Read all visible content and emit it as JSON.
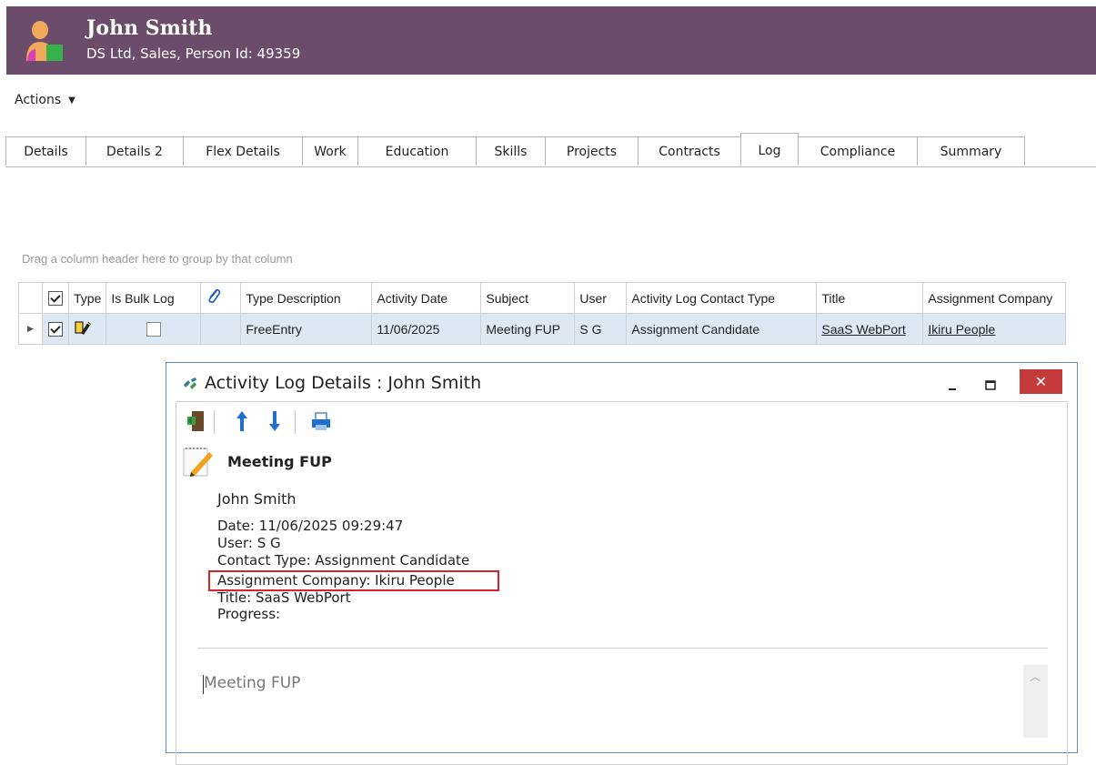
{
  "header": {
    "name": "John Smith",
    "subtitle": "DS Ltd, Sales, Person Id: 49359",
    "bg_color": "#6b4c6a",
    "avatar_icon": "person-avatar-icon"
  },
  "actions": {
    "label": "Actions",
    "caret_icon": "caret-down-icon"
  },
  "tabs": [
    {
      "label": "Details"
    },
    {
      "label": "Details 2"
    },
    {
      "label": "Flex Details"
    },
    {
      "label": "Work"
    },
    {
      "label": "Education"
    },
    {
      "label": "Skills"
    },
    {
      "label": "Projects"
    },
    {
      "label": "Contracts"
    },
    {
      "label": "Log",
      "active": true
    },
    {
      "label": "Compliance"
    },
    {
      "label": "Summary"
    }
  ],
  "grid": {
    "group_hint": "Drag a column header here to group by that column",
    "columns": {
      "type": "Type",
      "is_bulk_log": "Is Bulk Log",
      "attachment_icon": "paperclip-icon",
      "type_description": "Type Description",
      "activity_date": "Activity Date",
      "subject": "Subject",
      "user": "User",
      "contact_type": "Activity Log Contact Type",
      "title": "Title",
      "assignment_company": "Assignment Company"
    },
    "row": {
      "type_icon": "free-entry-icon",
      "type_description": "FreeEntry",
      "activity_date": "11/06/2025",
      "subject": "Meeting FUP",
      "user": "S G",
      "contact_type": "Assignment Candidate",
      "title": "SaaS WebPort",
      "assignment_company": "Ikiru People"
    }
  },
  "dialog": {
    "title": "Activity Log Details : John Smith",
    "close_label": "✕",
    "toolbar": [
      "exit-icon",
      "arrow-up-icon",
      "arrow-down-icon",
      "print-icon"
    ],
    "subject": "Meeting FUP",
    "contact": "John Smith",
    "details": {
      "date": "Date: 11/06/2025 09:29:47",
      "user": "User: S G",
      "contact_type": "Contact Type: Assignment Candidate",
      "assignment_company": "Assignment Company: Ikiru People",
      "title": "Title: SaaS WebPort",
      "progress": "Progress:"
    },
    "note_text": "Meeting FUP",
    "highlight_color": "#d9232a"
  }
}
